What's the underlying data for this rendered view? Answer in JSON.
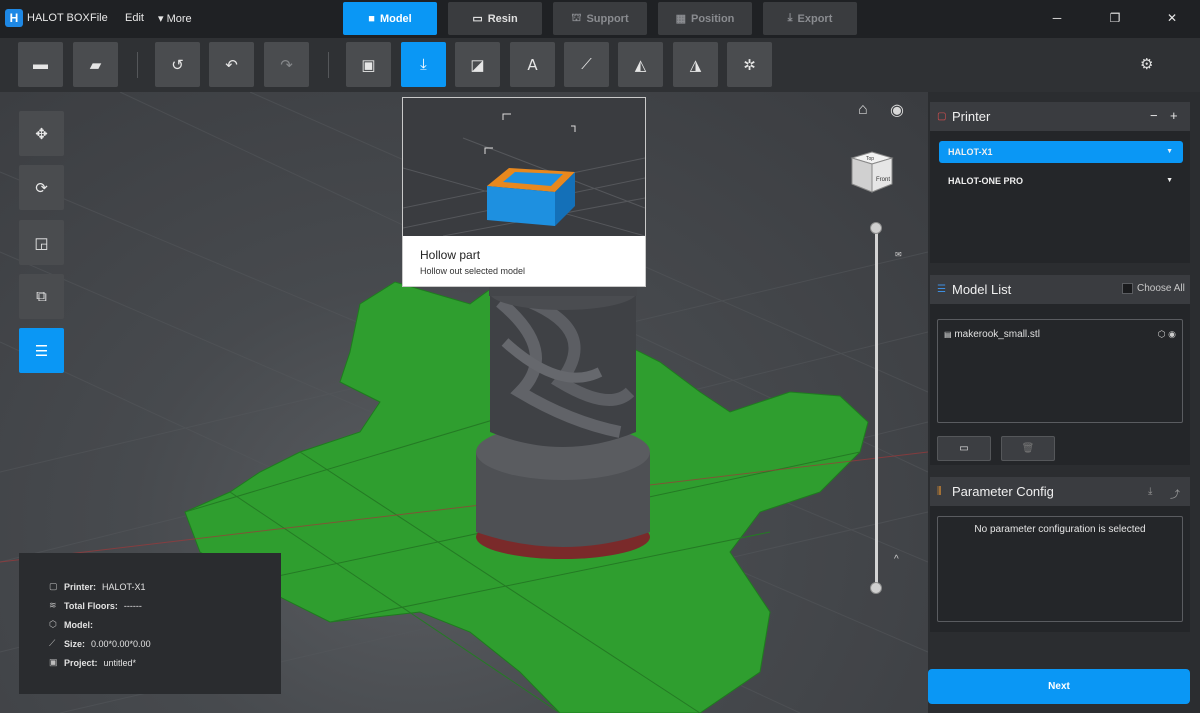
{
  "app": {
    "name": "HALOT BOX",
    "logo_letter": "H"
  },
  "menu": {
    "file": "File",
    "edit": "Edit",
    "more": "More"
  },
  "steps": [
    {
      "label": "Model",
      "state": "active"
    },
    {
      "label": "Resin",
      "state": "enabled"
    },
    {
      "label": "Support",
      "state": "disabled"
    },
    {
      "label": "Position",
      "state": "disabled"
    },
    {
      "label": "Export",
      "state": "disabled"
    }
  ],
  "window_controls": {
    "minimize": "─",
    "restore": "❐",
    "close": "✕"
  },
  "toolbar": {
    "icons": [
      "open-folder-icon",
      "save-icon",
      "history-icon",
      "undo-icon",
      "redo-icon",
      "print-icon",
      "hollow-icon",
      "cut-icon",
      "text-icon",
      "measure-icon",
      "eraser-icon",
      "mirror-icon",
      "lattice-icon",
      "settings-icon"
    ],
    "active": "hollow-icon"
  },
  "side_tools": [
    "move-icon",
    "rotate-icon",
    "scale-icon",
    "duplicate-icon",
    "list-icon"
  ],
  "tooltip": {
    "title": "Hollow part",
    "description": "Hollow out selected model"
  },
  "info": {
    "printer_label": "Printer:",
    "printer_value": "HALOT-X1",
    "floors_label": "Total Floors:",
    "floors_value": "------",
    "model_label": "Model:",
    "model_value": "",
    "size_label": "Size:",
    "size_value": "0.00*0.00*0.00",
    "project_label": "Project:",
    "project_value": "untitled*"
  },
  "view_cube": {
    "top": "Top",
    "front": "Front"
  },
  "slider": {
    "up_glyph": "^"
  },
  "printer_panel": {
    "title": "Printer",
    "printers": [
      {
        "name": "HALOT-X1",
        "selected": true
      },
      {
        "name": "HALOT-ONE PRO",
        "selected": false
      }
    ]
  },
  "model_list": {
    "title": "Model List",
    "choose_all": "Choose All",
    "items": [
      {
        "name": "makerook_small.stl"
      }
    ]
  },
  "parameter_config": {
    "title": "Parameter Config",
    "empty_message": "No parameter configuration is selected"
  },
  "next_button": "Next",
  "colors": {
    "accent": "#0a97f5",
    "plate": "#2f9e2f",
    "model": "#505256",
    "printer_icon": "#e05050",
    "list_icon": "#3d8ee0",
    "param_icon": "#e09030"
  }
}
